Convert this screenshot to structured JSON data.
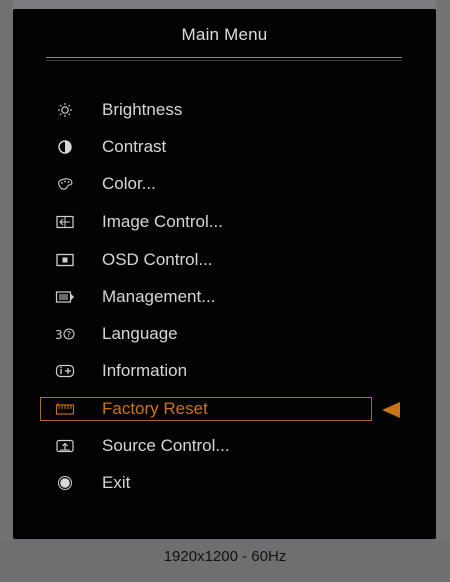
{
  "menu": {
    "title": "Main Menu",
    "items": [
      {
        "label": "Brightness",
        "icon": "brightness-icon"
      },
      {
        "label": "Contrast",
        "icon": "contrast-icon"
      },
      {
        "label": "Color...",
        "icon": "color-palette-icon"
      },
      {
        "label": "Image Control...",
        "icon": "image-control-icon"
      },
      {
        "label": "OSD Control...",
        "icon": "osd-control-icon"
      },
      {
        "label": "Management...",
        "icon": "management-icon"
      },
      {
        "label": "Language",
        "icon": "language-icon"
      },
      {
        "label": "Information",
        "icon": "information-icon"
      },
      {
        "label": "Factory Reset",
        "icon": "factory-reset-icon",
        "selected": true
      },
      {
        "label": "Source Control...",
        "icon": "source-control-icon"
      },
      {
        "label": "Exit",
        "icon": "exit-icon"
      }
    ]
  },
  "status": {
    "resolution": "1920x1200 - 60Hz"
  },
  "colors": {
    "selected": "#c8741c",
    "text": "#d6d6d6",
    "background": "#030303"
  }
}
